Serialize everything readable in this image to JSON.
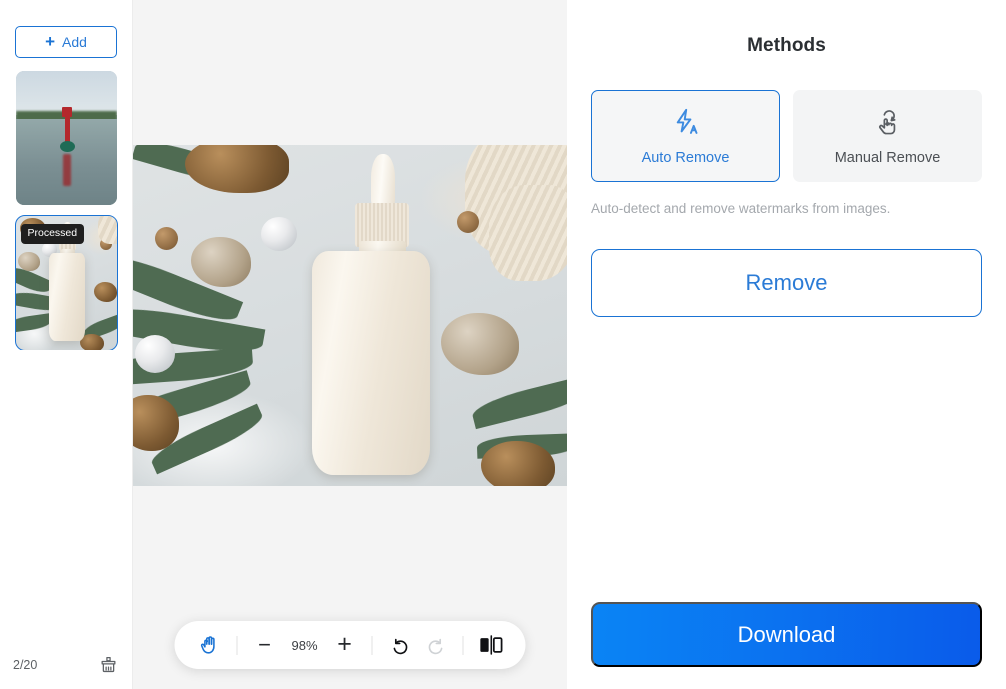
{
  "sidebar": {
    "add_button_label": "Add",
    "add_icon": "plus-icon",
    "thumbnails": [
      {
        "id": "thumb-1",
        "alt": "Red and green buoy on a lake",
        "badge": "",
        "selected": false
      },
      {
        "id": "thumb-2",
        "alt": "Cream dropper bottle on winter flatlay",
        "badge": "Processed",
        "selected": true
      }
    ],
    "footer": {
      "page_counter": "2/20",
      "clear_icon": "broom-icon"
    }
  },
  "canvas": {
    "image_alt": "Cream cosmetic dropper bottle surrounded by pine branches, pine cones, pearls and a knit sweater",
    "toolbar": {
      "hand_icon": "hand-icon",
      "zoom_out_icon": "minus-icon",
      "zoom_level": "98%",
      "zoom_in_icon": "plus-icon",
      "undo_icon": "undo-icon",
      "redo_icon": "redo-icon",
      "compare_icon": "compare-split-icon"
    }
  },
  "panel": {
    "title": "Methods",
    "methods": [
      {
        "label": "Auto Remove",
        "icon": "lightning-auto-icon",
        "active": true
      },
      {
        "label": "Manual Remove",
        "icon": "hand-tap-icon",
        "active": false
      }
    ],
    "description": "Auto-detect and remove watermarks from images.",
    "remove_label": "Remove",
    "download_label": "Download"
  },
  "colors": {
    "accent_blue": "#1a73d4",
    "link_blue": "#2b7bd6",
    "download_gradient_start": "#0a84f5",
    "download_gradient_end": "#0a5bea",
    "badge_bg": "#1f1f1f",
    "canvas_bg": "#f4f4f4",
    "card_bg": "#f3f4f5",
    "muted_text": "#a4a8ad"
  }
}
